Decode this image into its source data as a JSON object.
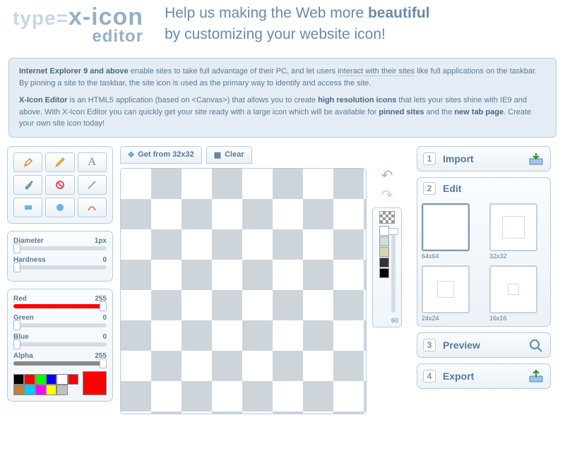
{
  "header": {
    "logo_prefix": "type=",
    "logo_main": "x-icon",
    "logo_sub": "editor",
    "tagline_line1_a": "Help us making the Web more ",
    "tagline_line1_b": "beautiful",
    "tagline_line2": "by customizing your website icon!"
  },
  "info": {
    "p1_bold1": "Internet Explorer 9 and above",
    "p1_text1": " enable sites to take full advantage of their PC, and let users ",
    "p1_link": "interact with their sites",
    "p1_text2": " like full applications on the taskbar. By pinning a site to the taskbar, the site icon is used as the primary way to identify and access the site.",
    "p2_bold1": "X-Icon Editor",
    "p2_text1": " is an HTML5 application (based on <Canvas>) that allows you to create ",
    "p2_bold2": "high resolution icons",
    "p2_text2": " that lets your sites shine with IE9 and above. With X-Icon Editor you can quickly get your site ready with a large icon which will be available for ",
    "p2_bold3": "pinned sites",
    "p2_text3": " and the ",
    "p2_bold4": "new tab page",
    "p2_text4": ". Create your own site icon today!"
  },
  "tools": {
    "items": [
      "brush",
      "pencil",
      "text",
      "eyedropper",
      "eraser",
      "line",
      "rectangle",
      "circle",
      "curve"
    ]
  },
  "sliders": {
    "diameter": {
      "label": "Diameter",
      "value": "1px",
      "pos": 0
    },
    "hardness": {
      "label": "Hardness",
      "value": "0",
      "pos": 0
    },
    "red": {
      "label": "Red",
      "value": "255",
      "pos": 100,
      "color": "#ff0000"
    },
    "green": {
      "label": "Green",
      "value": "0",
      "pos": 0,
      "color": "#00aa00"
    },
    "blue": {
      "label": "Blue",
      "value": "0",
      "pos": 0,
      "color": "#2288dd"
    },
    "alpha": {
      "label": "Alpha",
      "value": "255",
      "pos": 100,
      "color": "#888888"
    }
  },
  "swatches": [
    "#000000",
    "#ff0000",
    "#00ff00",
    "#0000ff",
    "#ffffff",
    "#ff0000",
    "#c08040",
    "#00ccff",
    "#ff00ff",
    "#ffff00",
    "#c0c0c0"
  ],
  "current_color": "#ff0000",
  "canvas": {
    "get_from": "Get from 32x32",
    "clear": "Clear"
  },
  "opacity": {
    "colors": [
      "#ffffff",
      "#cfe0da",
      "#d5d9b0",
      "#333333",
      "#000000"
    ],
    "value": "60"
  },
  "steps": {
    "import": {
      "num": "1",
      "title": "Import"
    },
    "edit": {
      "num": "2",
      "title": "Edit"
    },
    "preview": {
      "num": "3",
      "title": "Preview"
    },
    "export": {
      "num": "4",
      "title": "Export"
    }
  },
  "thumbs": [
    {
      "label": "64x64",
      "size": 64,
      "selected": true
    },
    {
      "label": "32x32",
      "size": 32,
      "selected": false
    },
    {
      "label": "24x24",
      "size": 24,
      "selected": false
    },
    {
      "label": "16x16",
      "size": 16,
      "selected": false
    }
  ]
}
